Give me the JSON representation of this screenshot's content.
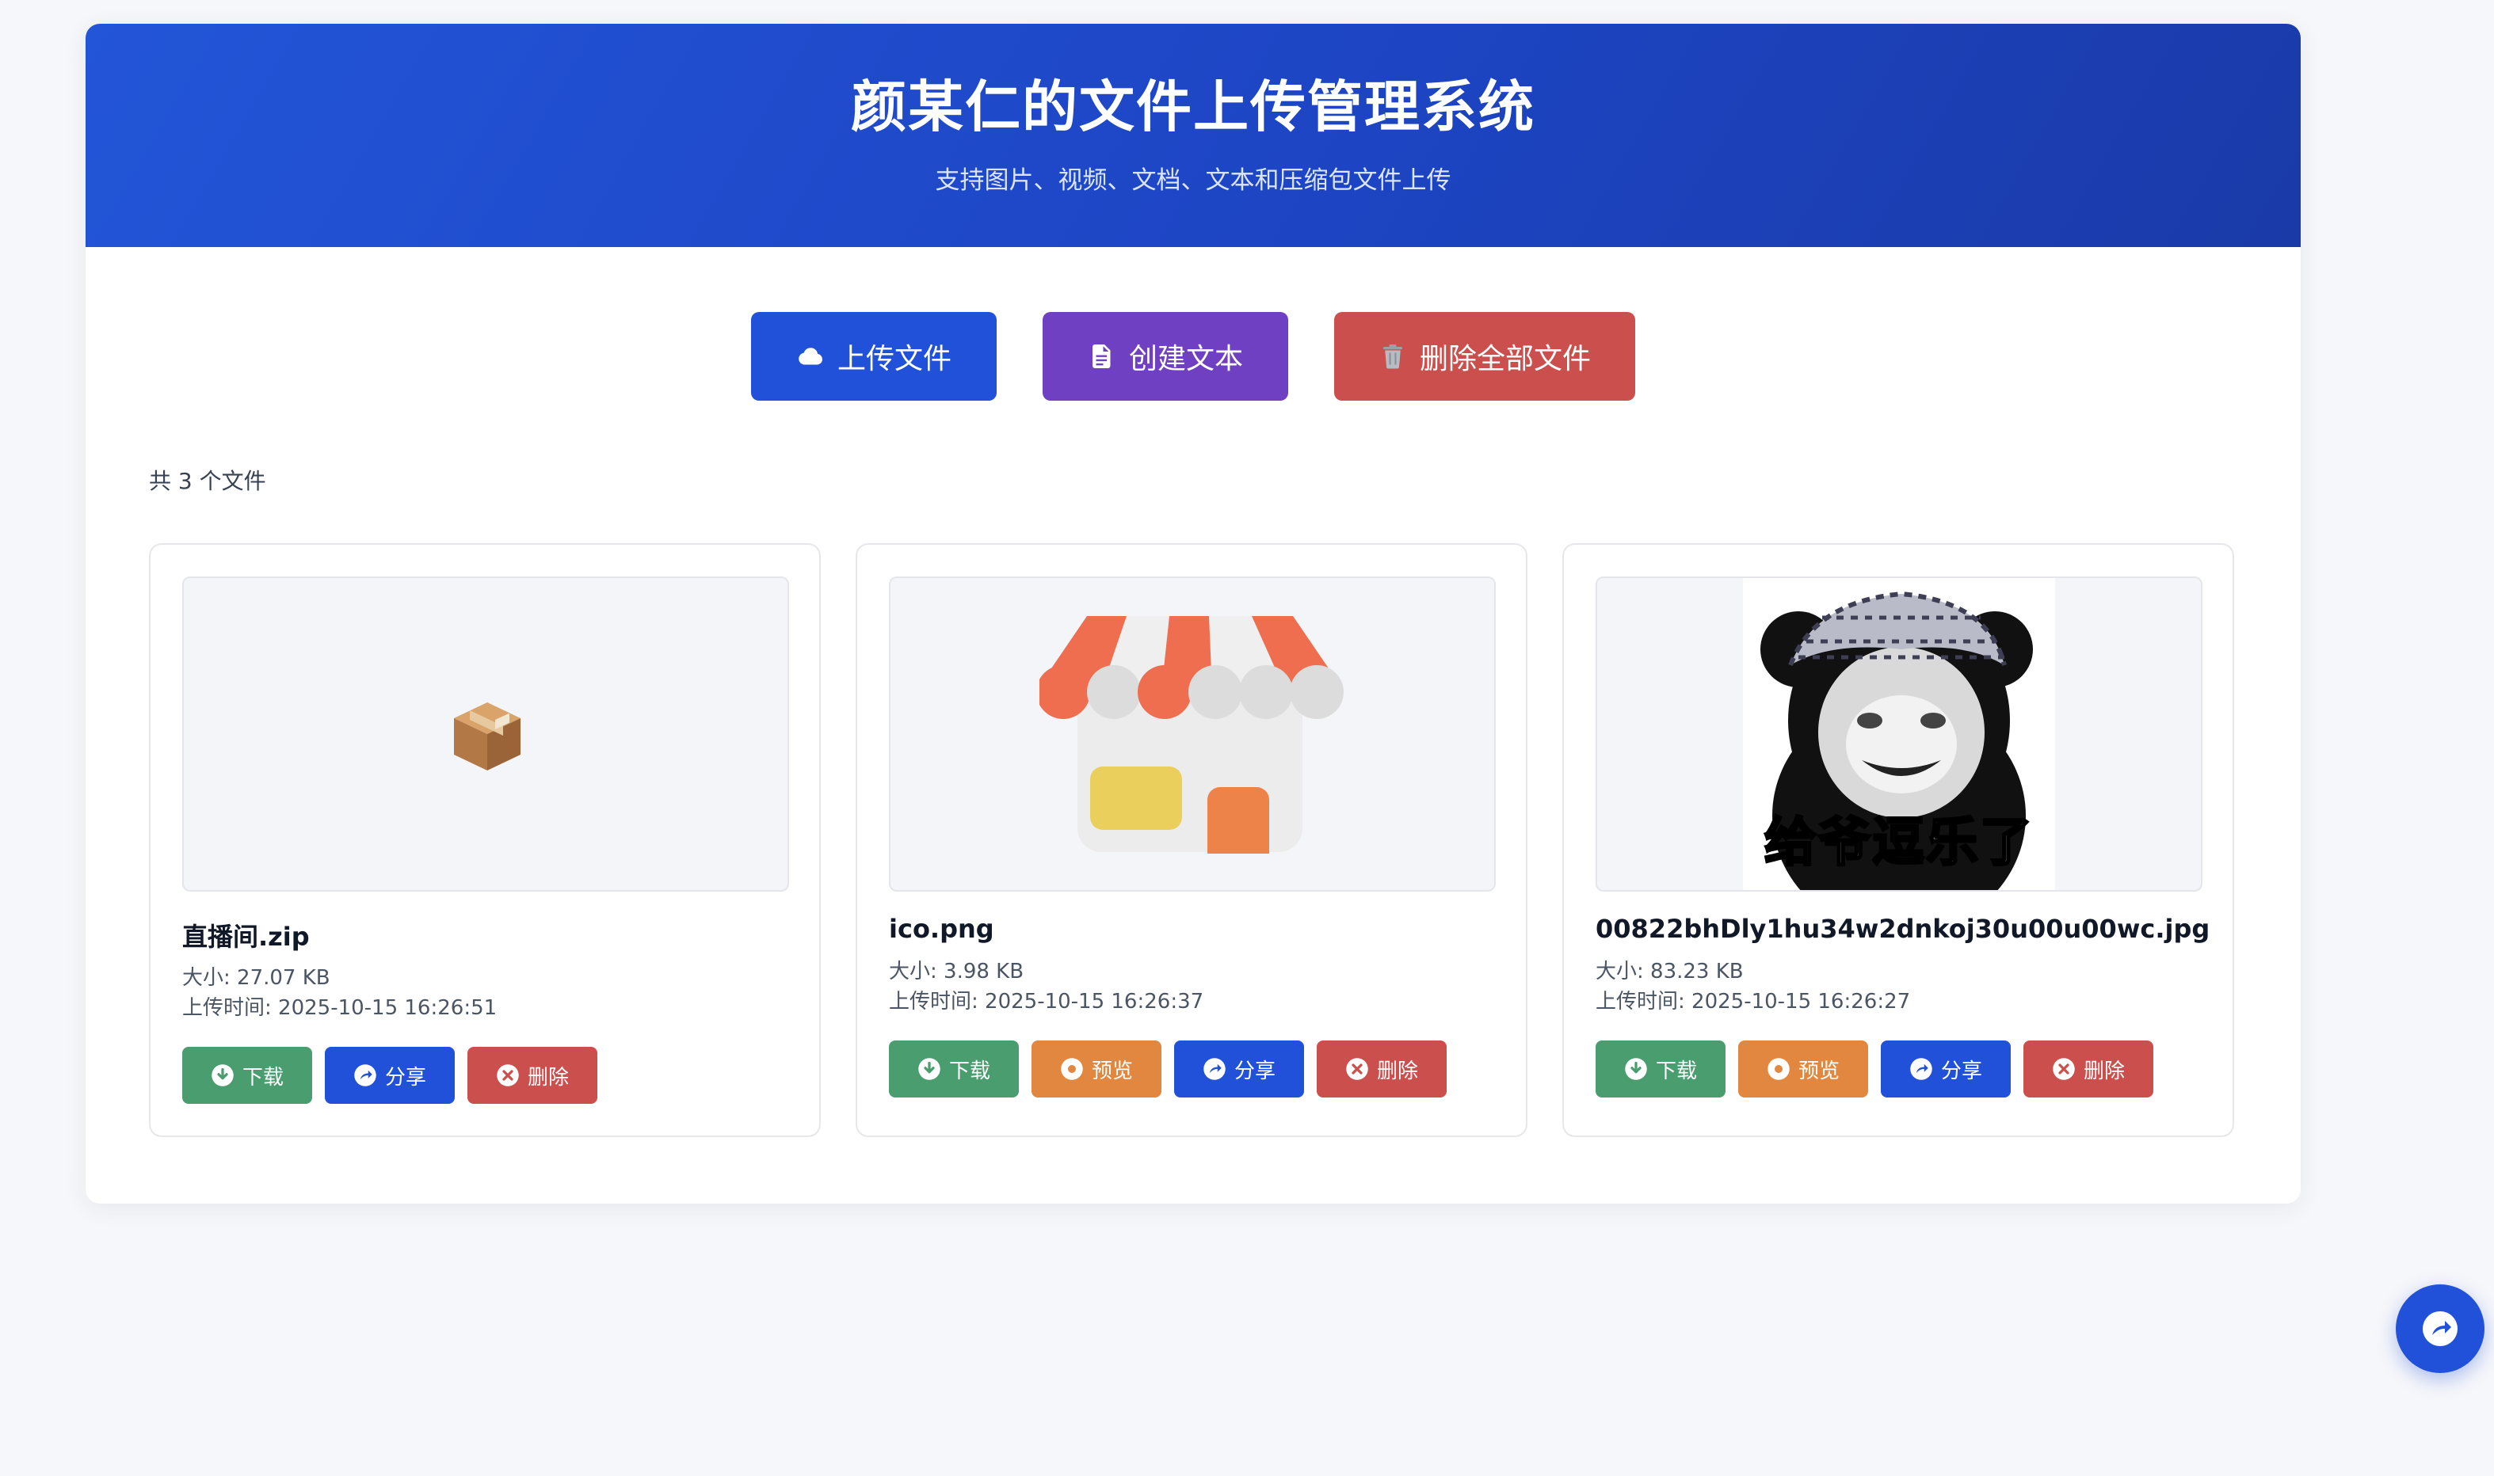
{
  "header": {
    "title": "颜某仁的文件上传管理系统",
    "subtitle": "支持图片、视频、文档、文本和压缩包文件上传"
  },
  "actions": {
    "upload_label": "上传文件",
    "create_text_label": "创建文本",
    "delete_all_label": "删除全部文件"
  },
  "file_count_text": "共 3 个文件",
  "files": [
    {
      "name": "直播间.zip",
      "size": "大小: 27.07 KB",
      "upload_time": "上传时间: 2025-10-15 16:26:51",
      "buttons": {
        "download": "下载",
        "share": "分享",
        "delete": "删除"
      }
    },
    {
      "name": "ico.png",
      "size": "大小: 3.98 KB",
      "upload_time": "上传时间: 2025-10-15 16:26:37",
      "buttons": {
        "download": "下载",
        "preview": "预览",
        "share": "分享",
        "delete": "删除"
      }
    },
    {
      "name": "00822bhDly1hu34w2dnkoj30u00u00wc.jpg",
      "size": "大小: 83.23 KB",
      "upload_time": "上传时间: 2025-10-15 16:26:27",
      "image_caption": "给爷逗乐了",
      "buttons": {
        "download": "下载",
        "preview": "预览",
        "share": "分享",
        "delete": "删除"
      }
    }
  ],
  "colors": {
    "primary": "#2151d9",
    "purple": "#6f40c1",
    "danger": "#cb4f4c",
    "success": "#4a9d6e",
    "warning": "#e2873f"
  },
  "icons": {
    "upload": "cloud-icon",
    "create_text": "document-icon",
    "delete_all": "trash-icon",
    "download": "download-icon",
    "preview": "preview-icon",
    "share": "share-icon",
    "delete": "delete-icon",
    "fab": "share-icon"
  }
}
